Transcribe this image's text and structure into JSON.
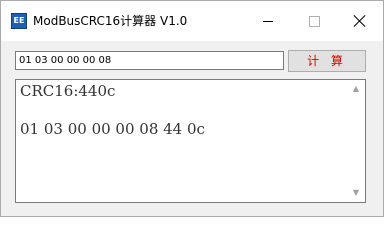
{
  "window": {
    "icon_text": "EE",
    "title": "ModBusCRC16计算器 V1.0"
  },
  "input": {
    "value": "01 03 00 00 00 08"
  },
  "button": {
    "label": "计 算"
  },
  "output": {
    "line1": "CRC16:440c",
    "line2": "01 03 00 00 00 08 44 0c"
  },
  "colors": {
    "button_text": "#e00000",
    "icon_bg": "#1e5fb4"
  }
}
